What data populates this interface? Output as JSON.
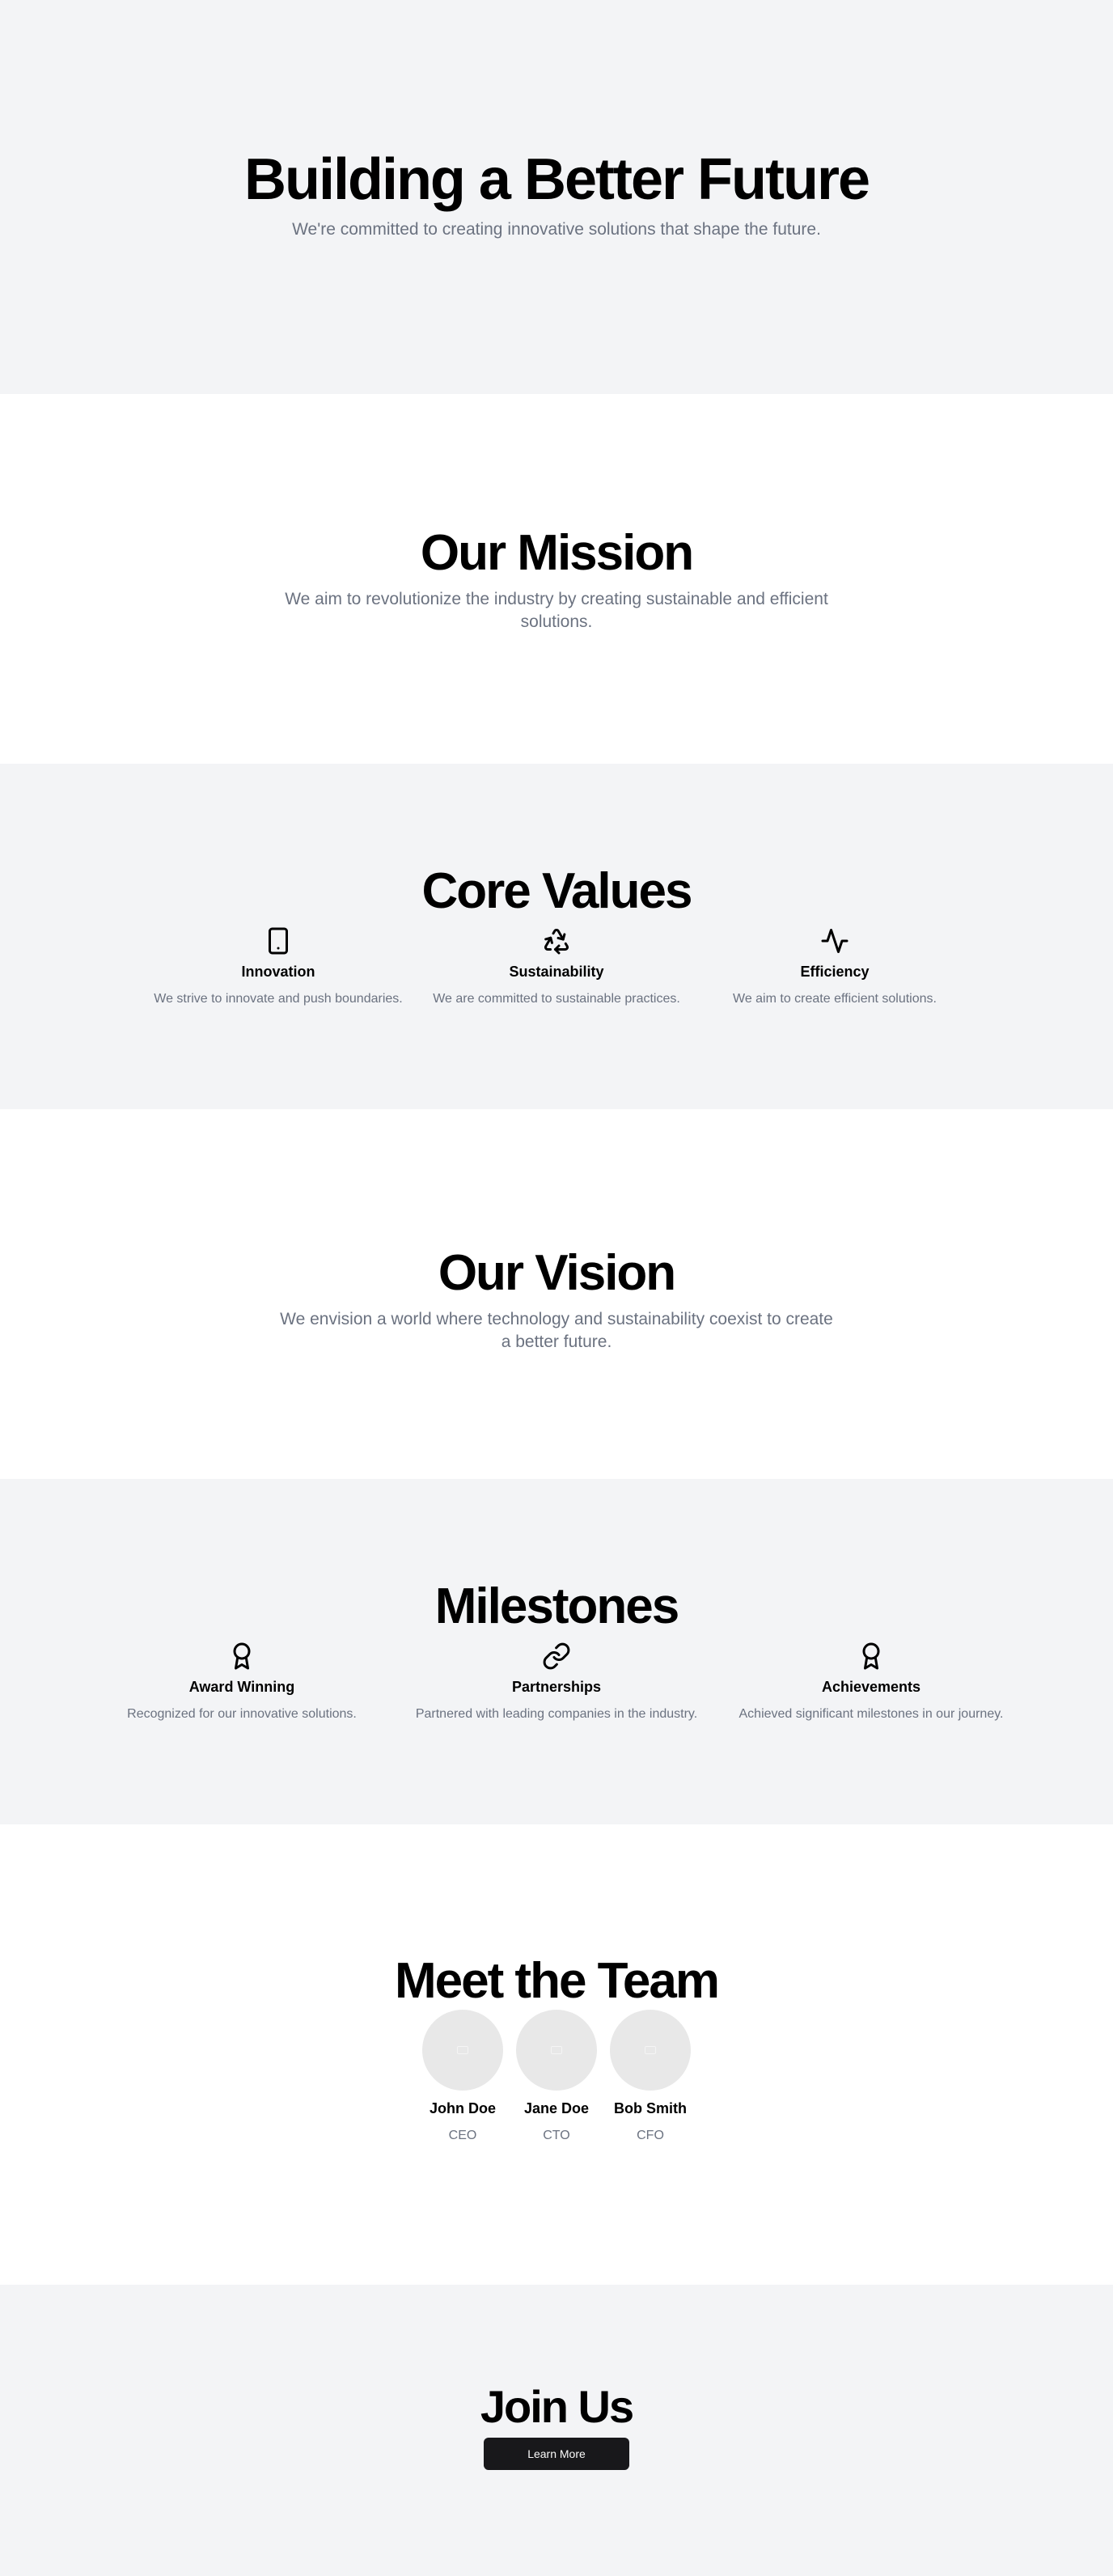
{
  "hero": {
    "title": "Building a Better Future",
    "subtitle": "We're committed to creating innovative solutions that shape the future."
  },
  "mission": {
    "title": "Our Mission",
    "text": "We aim to revolutionize the industry by creating sustainable and efficient solutions."
  },
  "values": {
    "title": "Core Values",
    "items": [
      {
        "icon": "tablet-icon",
        "title": "Innovation",
        "desc": "We strive to innovate and push boundaries."
      },
      {
        "icon": "recycle-icon",
        "title": "Sustainability",
        "desc": "We are committed to sustainable practices."
      },
      {
        "icon": "activity-icon",
        "title": "Efficiency",
        "desc": "We aim to create efficient solutions."
      }
    ]
  },
  "vision": {
    "title": "Our Vision",
    "text": "We envision a world where technology and sustainability coexist to create a better future."
  },
  "milestones": {
    "title": "Milestones",
    "items": [
      {
        "icon": "award-icon",
        "title": "Award Winning",
        "desc": "Recognized for our innovative solutions."
      },
      {
        "icon": "link-icon",
        "title": "Partnerships",
        "desc": "Partnered with leading companies in the industry."
      },
      {
        "icon": "award-icon",
        "title": "Achievements",
        "desc": "Achieved significant milestones in our journey."
      }
    ]
  },
  "team": {
    "title": "Meet the Team",
    "members": [
      {
        "name": "John Doe",
        "role": "CEO"
      },
      {
        "name": "Jane Doe",
        "role": "CTO"
      },
      {
        "name": "Bob Smith",
        "role": "CFO"
      }
    ]
  },
  "join": {
    "title": "Join Us",
    "button": "Learn More"
  },
  "colors": {
    "section_gray": "#f3f4f6",
    "muted_text": "#6b7280",
    "button_bg": "#18181b"
  }
}
